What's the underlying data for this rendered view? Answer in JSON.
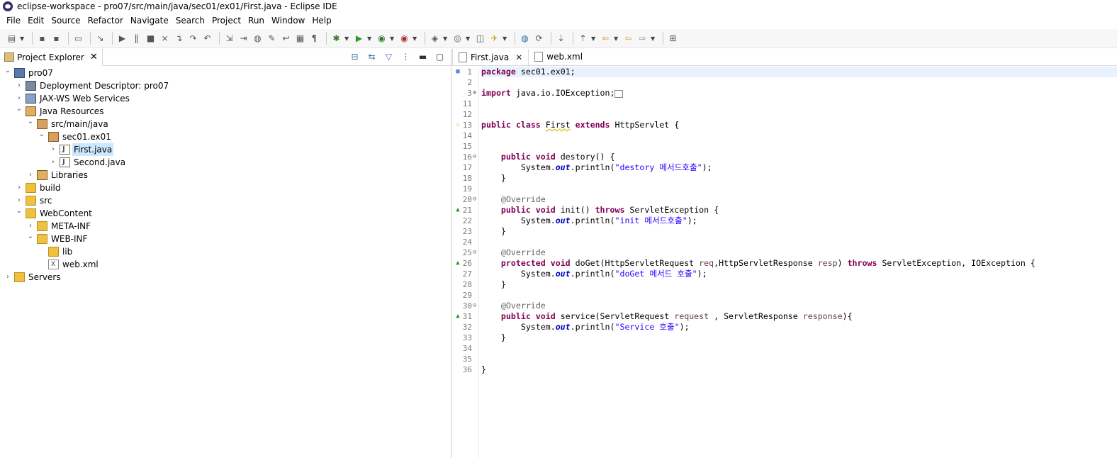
{
  "window": {
    "title": "eclipse-workspace - pro07/src/main/java/sec01/ex01/First.java - Eclipse IDE"
  },
  "menu": [
    "File",
    "Edit",
    "Source",
    "Refactor",
    "Navigate",
    "Search",
    "Project",
    "Run",
    "Window",
    "Help"
  ],
  "toolbar": {
    "icons": [
      "new-icon",
      "save-icon",
      "save-all-icon",
      "console-icon",
      "skip-icon",
      "resume-icon",
      "suspend-icon",
      "terminate-icon",
      "disconnect-icon",
      "step-into-icon",
      "step-over-icon",
      "step-return-icon",
      "drop-frame-icon",
      "use-step-filters-icon",
      "toggle-breadpoint-icon",
      "toggle-mark-icon",
      "word-wrap-icon",
      "block-select-icon",
      "whitespace-icon",
      "debug-icon",
      "run-icon",
      "coverage-icon",
      "external-tools-icon",
      "new-java-project-icon",
      "new-class-icon",
      "open-type-icon",
      "search-icon",
      "globe-icon",
      "refresh-icon",
      "next-annotation-icon",
      "prev-annotation-icon",
      "last-edit-icon",
      "back-icon",
      "forward-icon",
      "perspective-icon"
    ]
  },
  "explorer": {
    "tab_label": "Project Explorer",
    "tree": [
      {
        "label": "pro07",
        "depth": 0,
        "expanded": true,
        "icon": "project-icon"
      },
      {
        "label": "Deployment Descriptor: pro07",
        "depth": 1,
        "expanded": false,
        "icon": "descriptor-icon"
      },
      {
        "label": "JAX-WS Web Services",
        "depth": 1,
        "expanded": false,
        "icon": "webservices-icon"
      },
      {
        "label": "Java Resources",
        "depth": 1,
        "expanded": true,
        "icon": "java-resources-icon"
      },
      {
        "label": "src/main/java",
        "depth": 2,
        "expanded": true,
        "icon": "source-folder-icon"
      },
      {
        "label": "sec01.ex01",
        "depth": 3,
        "expanded": true,
        "icon": "package-icon"
      },
      {
        "label": "First.java",
        "depth": 4,
        "expanded": false,
        "icon": "java-file-icon",
        "selected": true
      },
      {
        "label": "Second.java",
        "depth": 4,
        "expanded": false,
        "icon": "java-file-icon"
      },
      {
        "label": "Libraries",
        "depth": 2,
        "expanded": false,
        "icon": "libraries-icon"
      },
      {
        "label": "build",
        "depth": 1,
        "expanded": false,
        "icon": "folder-icon"
      },
      {
        "label": "src",
        "depth": 1,
        "expanded": false,
        "icon": "folder-icon"
      },
      {
        "label": "WebContent",
        "depth": 1,
        "expanded": true,
        "icon": "folder-icon"
      },
      {
        "label": "META-INF",
        "depth": 2,
        "expanded": false,
        "icon": "folder-icon"
      },
      {
        "label": "WEB-INF",
        "depth": 2,
        "expanded": true,
        "icon": "folder-icon"
      },
      {
        "label": "lib",
        "depth": 3,
        "leaf": true,
        "icon": "folder-icon"
      },
      {
        "label": "web.xml",
        "depth": 3,
        "leaf": true,
        "icon": "xml-file-icon"
      },
      {
        "label": "Servers",
        "depth": 0,
        "expanded": false,
        "icon": "servers-folder-icon"
      }
    ]
  },
  "editor": {
    "tabs": [
      {
        "label": "First.java",
        "active": true
      },
      {
        "label": "web.xml",
        "active": false
      }
    ],
    "lines": [
      {
        "n": "1",
        "html": "<span class=\"kw\">package</span> sec01.ex01;",
        "cur": true,
        "mk": "■"
      },
      {
        "n": "2",
        "html": ""
      },
      {
        "n": "3",
        "html": "<span class=\"kw\">import</span> java.io.IOException;<span style=\"border:1px solid #888;font-size:8px\">  </span>",
        "fold": "⊕"
      },
      {
        "n": "11",
        "html": ""
      },
      {
        "n": "12",
        "html": ""
      },
      {
        "n": "13",
        "html": "<span class=\"kw\">public</span> <span class=\"kw\">class</span> <span class=\"ul\">First</span> <span class=\"kw\">extends</span> HttpServlet {",
        "mk": "⚠"
      },
      {
        "n": "14",
        "html": ""
      },
      {
        "n": "15",
        "html": ""
      },
      {
        "n": "16",
        "html": "    <span class=\"kw\">public</span> <span class=\"kw\">void</span> destory() {",
        "fold": "⊖"
      },
      {
        "n": "17",
        "html": "        System.<span class=\"fld\">out</span>.println(<span class=\"str\">\"destory 메서드호출\"</span>);"
      },
      {
        "n": "18",
        "html": "    }"
      },
      {
        "n": "19",
        "html": ""
      },
      {
        "n": "20",
        "html": "    <span class=\"ann\">@Override</span>",
        "fold": "⊖"
      },
      {
        "n": "21",
        "html": "    <span class=\"kw\">public</span> <span class=\"kw\">void</span> init() <span class=\"kw\">throws</span> ServletException {",
        "mk": "▲"
      },
      {
        "n": "22",
        "html": "        System.<span class=\"fld\">out</span>.println(<span class=\"str\">\"init 메서드호출\"</span>);"
      },
      {
        "n": "23",
        "html": "    }"
      },
      {
        "n": "24",
        "html": ""
      },
      {
        "n": "25",
        "html": "    <span class=\"ann\">@Override</span>",
        "fold": "⊖"
      },
      {
        "n": "26",
        "html": "    <span class=\"kw\">protected</span> <span class=\"kw\">void</span> doGet(HttpServletRequest <span class=\"prm\">req</span>,HttpServletResponse <span class=\"prm\">resp</span>) <span class=\"kw\">throws</span> ServletException, IOException {",
        "mk": "▲"
      },
      {
        "n": "27",
        "html": "        System.<span class=\"fld\">out</span>.println(<span class=\"str\">\"doGet 메서드 호출\"</span>);"
      },
      {
        "n": "28",
        "html": "    }"
      },
      {
        "n": "29",
        "html": ""
      },
      {
        "n": "30",
        "html": "    <span class=\"ann\">@Override</span>",
        "fold": "⊖"
      },
      {
        "n": "31",
        "html": "    <span class=\"kw\">public</span> <span class=\"kw\">void</span> service(ServletRequest <span class=\"prm\">request</span> , ServletResponse <span class=\"prm\">response</span>){",
        "mk": "▲"
      },
      {
        "n": "32",
        "html": "        System.<span class=\"fld\">out</span>.println(<span class=\"str\">\"Service 호출\"</span>);"
      },
      {
        "n": "33",
        "html": "    }"
      },
      {
        "n": "34",
        "html": ""
      },
      {
        "n": "35",
        "html": ""
      },
      {
        "n": "36",
        "html": "}"
      }
    ]
  }
}
